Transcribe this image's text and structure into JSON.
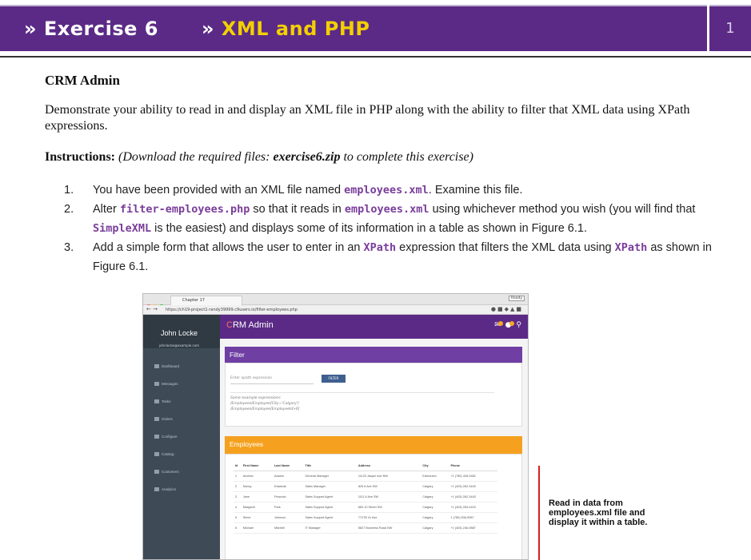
{
  "header": {
    "left_chevron": "»",
    "left_title": "Exercise 6",
    "right_chevron": "»",
    "right_title": "XML and PHP",
    "page_number": "1",
    "bar_color": "#5b2a86",
    "accent_color": "#f2d000"
  },
  "content": {
    "section_title": "CRM Admin",
    "description": "Demonstrate your ability to read in and display an XML file in PHP along with the ability to filter that XML data using XPath expressions.",
    "instructions_label": "Instructions:",
    "instructions_pre": "(Download the required files: ",
    "instructions_file": "exercise6.zip",
    "instructions_post": " to complete this exercise)",
    "steps": [
      {
        "num": "1.",
        "t1": "You have been provided with an XML file named ",
        "c1": "employees.xml",
        "t2": ". Examine this file."
      },
      {
        "num": "2.",
        "t1": "Alter ",
        "c1": "filter-employees.php",
        "t2": " so that it reads in ",
        "c2": "employees.xml",
        "t3": " using whichever method you wish (you will find that ",
        "c3": "SimpleXML",
        "t4": " is the easiest) and displays some of its information in a table as shown in Figure 6.1."
      },
      {
        "num": "3.",
        "t1": "Add a simple form that allows the user to enter in an ",
        "c1": "XPath",
        "t2": " expression that filters the XML data using ",
        "c2": "XPath",
        "t3": " as shown in Figure 6.1."
      }
    ]
  },
  "figure": {
    "tab_title": "Chapter 17",
    "ready_label": "Ready",
    "url": "https://ch19-project1-randy39999.c9users.io/filter-employees.php",
    "user_name": "John Locke",
    "user_email": "johnlocke@example.com",
    "brand_prefix": "C",
    "brand_rest": "RM Admin",
    "sidebar_items": [
      "Dashboard",
      "Messages",
      "Tasks",
      "Orders",
      "Configure",
      "Catalog",
      "Customers",
      "Analytics"
    ],
    "filter_panel_title": "Filter",
    "xpath_placeholder": "Enter xpath expression",
    "filter_button": "FILTER",
    "examples_title": "Some example expressions:",
    "example_1": "/Employees/Employee[City='Calgary']",
    "example_2": "/Employees/Employee[EmployeeId>6]",
    "employees_panel_title": "Employees",
    "table_headers": [
      "Id",
      "First Name",
      "Last Name",
      "Title",
      "Address",
      "City",
      "Phone"
    ],
    "table_rows": [
      [
        "1",
        "Andrew",
        "Adams",
        "General Manager",
        "11120 Jasper Ave NW",
        "Edmonton",
        "+1 (780) 428-9482"
      ],
      [
        "2",
        "Nancy",
        "Edwards",
        "Sales Manager",
        "825 8 Ave SW",
        "Calgary",
        "+1 (403) 262-3443"
      ],
      [
        "3",
        "Jane",
        "Peacock",
        "Sales Support Agent",
        "1111 6 Ave SW",
        "Calgary",
        "+1 (403) 262-3443"
      ],
      [
        "4",
        "Margaret",
        "Park",
        "Sales Support Agent",
        "683 10 Street SW",
        "Calgary",
        "+1 (403) 263-4423"
      ],
      [
        "5",
        "Steve",
        "Johnson",
        "Sales Support Agent",
        "7727B 41 Ave",
        "Calgary",
        "1 (780) 836-9987"
      ],
      [
        "6",
        "Michael",
        "Mitchell",
        "IT Manager",
        "5827 Bowness Road NW",
        "Calgary",
        "+1 (403) 246-9887"
      ]
    ]
  },
  "annotation": {
    "text": "Read in data from employees.xml file and display it within a table.",
    "line_color": "#d12020"
  }
}
